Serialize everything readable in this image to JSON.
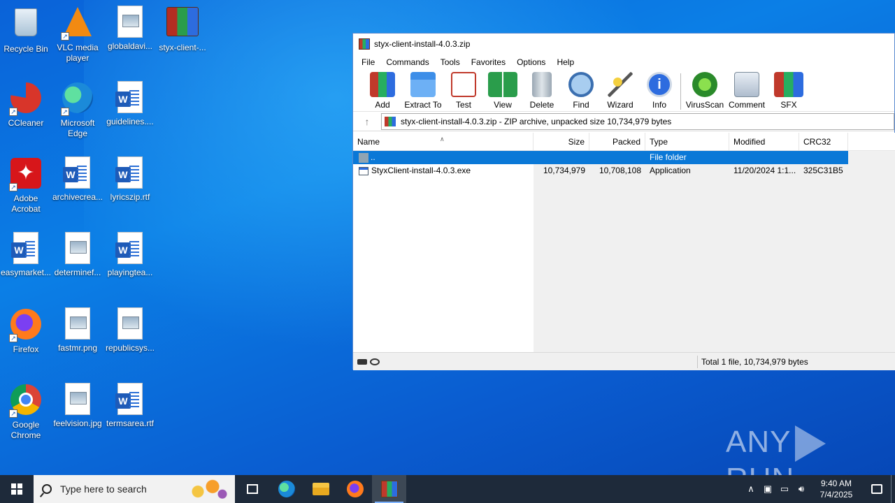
{
  "desktop": {
    "icons": [
      {
        "label": "Recycle Bin",
        "icon": "recycle-bin-icon"
      },
      {
        "label": "VLC media player",
        "icon": "vlc-icon"
      },
      {
        "label": "globaldavi...",
        "icon": "image-file-icon"
      },
      {
        "label": "styx-client-...",
        "icon": "winrar-archive-icon"
      },
      {
        "label": "CCleaner",
        "icon": "ccleaner-icon"
      },
      {
        "label": "Microsoft Edge",
        "icon": "edge-icon"
      },
      {
        "label": "guidelines....",
        "icon": "word-doc-icon"
      },
      {
        "label": "Adobe Acrobat",
        "icon": "acrobat-icon"
      },
      {
        "label": "archivecrea...",
        "icon": "word-doc-icon"
      },
      {
        "label": "lyricszip.rtf",
        "icon": "word-doc-icon"
      },
      {
        "label": "easymarket...",
        "icon": "word-doc-icon"
      },
      {
        "label": "determinef...",
        "icon": "image-file-icon"
      },
      {
        "label": "playingtea...",
        "icon": "word-doc-icon"
      },
      {
        "label": "Firefox",
        "icon": "firefox-icon"
      },
      {
        "label": "fastmr.png",
        "icon": "image-file-icon"
      },
      {
        "label": "republicsys...",
        "icon": "image-file-icon"
      },
      {
        "label": "Google Chrome",
        "icon": "chrome-icon"
      },
      {
        "label": "feelvision.jpg",
        "icon": "image-file-icon"
      },
      {
        "label": "termsarea.rtf",
        "icon": "word-doc-icon"
      }
    ]
  },
  "winrar": {
    "title": "styx-client-install-4.0.3.zip",
    "menu": [
      "File",
      "Commands",
      "Tools",
      "Favorites",
      "Options",
      "Help"
    ],
    "toolbar": [
      {
        "label": "Add",
        "icon": "add-icon"
      },
      {
        "label": "Extract To",
        "icon": "extract-to-icon"
      },
      {
        "label": "Test",
        "icon": "test-icon"
      },
      {
        "label": "View",
        "icon": "view-icon"
      },
      {
        "label": "Delete",
        "icon": "delete-icon"
      },
      {
        "label": "Find",
        "icon": "find-icon"
      },
      {
        "label": "Wizard",
        "icon": "wizard-icon"
      },
      {
        "label": "Info",
        "icon": "info-icon"
      },
      {
        "label": "VirusScan",
        "icon": "virusscan-icon"
      },
      {
        "label": "Comment",
        "icon": "comment-icon"
      },
      {
        "label": "SFX",
        "icon": "sfx-icon"
      }
    ],
    "address": "styx-client-install-4.0.3.zip - ZIP archive, unpacked size 10,734,979 bytes",
    "columns": {
      "name": "Name",
      "size": "Size",
      "packed": "Packed",
      "type": "Type",
      "modified": "Modified",
      "crc": "CRC32"
    },
    "rows": [
      {
        "name": "..",
        "size": "",
        "packed": "",
        "type": "File folder",
        "modified": "",
        "crc": "",
        "selected": true
      },
      {
        "name": "StyxClient-install-4.0.3.exe",
        "size": "10,734,979",
        "packed": "10,708,108",
        "type": "Application",
        "modified": "11/20/2024 1:1...",
        "crc": "325C31B5",
        "selected": false
      }
    ],
    "status": "Total 1 file, 10,734,979 bytes"
  },
  "watermark": {
    "left": "ANY",
    "right": "RUN"
  },
  "taskbar": {
    "search_placeholder": "Type here to search",
    "time": "9:40 AM",
    "date": "7/4/2025"
  },
  "colors": {
    "accent": "#0a78d7",
    "taskbar": "#1e2a3a",
    "desktop": "#0b7fe6"
  }
}
